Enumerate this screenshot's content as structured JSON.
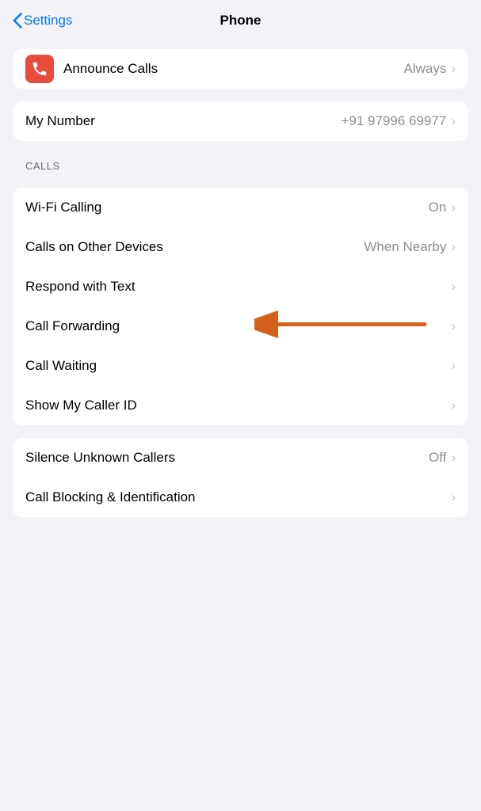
{
  "header": {
    "back_label": "Settings",
    "title": "Phone"
  },
  "sections": [
    {
      "id": "announce",
      "label": null,
      "rows": [
        {
          "id": "announce-calls",
          "icon": "phone-icon",
          "icon_color": "#e74c3c",
          "label": "Announce Calls",
          "value": "Always",
          "has_chevron": true
        }
      ]
    },
    {
      "id": "my-number",
      "label": null,
      "rows": [
        {
          "id": "my-number",
          "icon": null,
          "label": "My Number",
          "value": "+91 97996 69977",
          "has_chevron": true
        }
      ]
    },
    {
      "id": "calls",
      "label": "CALLS",
      "rows": [
        {
          "id": "wifi-calling",
          "icon": null,
          "label": "Wi-Fi Calling",
          "value": "On",
          "has_chevron": true,
          "annotated": false
        },
        {
          "id": "calls-other-devices",
          "icon": null,
          "label": "Calls on Other Devices",
          "value": "When Nearby",
          "has_chevron": true,
          "annotated": false
        },
        {
          "id": "respond-text",
          "icon": null,
          "label": "Respond with Text",
          "value": "",
          "has_chevron": true,
          "annotated": false
        },
        {
          "id": "call-forwarding",
          "icon": null,
          "label": "Call Forwarding",
          "value": "",
          "has_chevron": true,
          "annotated": true
        },
        {
          "id": "call-waiting",
          "icon": null,
          "label": "Call Waiting",
          "value": "",
          "has_chevron": true,
          "annotated": false
        },
        {
          "id": "caller-id",
          "icon": null,
          "label": "Show My Caller ID",
          "value": "",
          "has_chevron": true,
          "annotated": false
        }
      ]
    },
    {
      "id": "blocking",
      "label": null,
      "rows": [
        {
          "id": "silence-unknown",
          "icon": null,
          "label": "Silence Unknown Callers",
          "value": "Off",
          "has_chevron": true
        },
        {
          "id": "call-blocking",
          "icon": null,
          "label": "Call Blocking & Identification",
          "value": "",
          "has_chevron": true
        }
      ]
    }
  ],
  "arrow": {
    "color": "#d4611a"
  }
}
